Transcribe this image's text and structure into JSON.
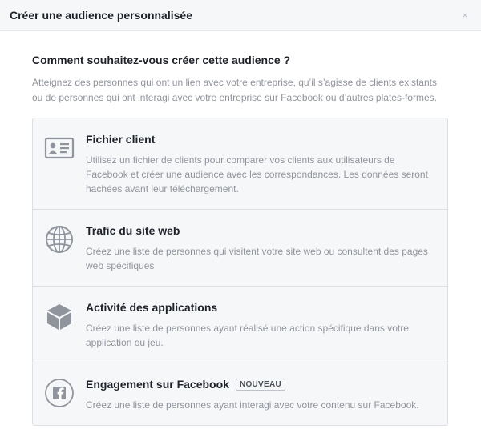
{
  "dialog": {
    "title": "Créer une audience personnalisée",
    "close_symbol": "×"
  },
  "main": {
    "question": "Comment souhaitez-vous créer cette audience ?",
    "intro": "Atteignez des personnes qui ont un lien avec votre entreprise, qu’il s’agisse de clients existants ou de personnes qui ont interagi avec votre entreprise sur Facebook ou d’autres plates-formes."
  },
  "options": [
    {
      "icon": "contact-card-icon",
      "title": "Fichier client",
      "description": "Utilisez un fichier de clients pour comparer vos clients aux utilisateurs de Facebook et créer une audience avec les correspondances. Les données seront hachées avant leur téléchargement."
    },
    {
      "icon": "globe-icon",
      "title": "Trafic du site web",
      "description": "Créez une liste de personnes qui visitent votre site web ou consultent des pages web spécifiques"
    },
    {
      "icon": "cube-icon",
      "title": "Activité des applications",
      "description": "Créez une liste de personnes ayant réalisé une action spécifique dans votre application ou jeu."
    },
    {
      "icon": "facebook-icon",
      "title": "Engagement sur Facebook",
      "badge": "NOUVEAU",
      "description": "Créez une liste de personnes ayant interagi avec votre contenu sur Facebook."
    }
  ],
  "colors": {
    "icon": "#90949c",
    "header_bg": "#f6f7f9",
    "border": "#dddfe2"
  }
}
